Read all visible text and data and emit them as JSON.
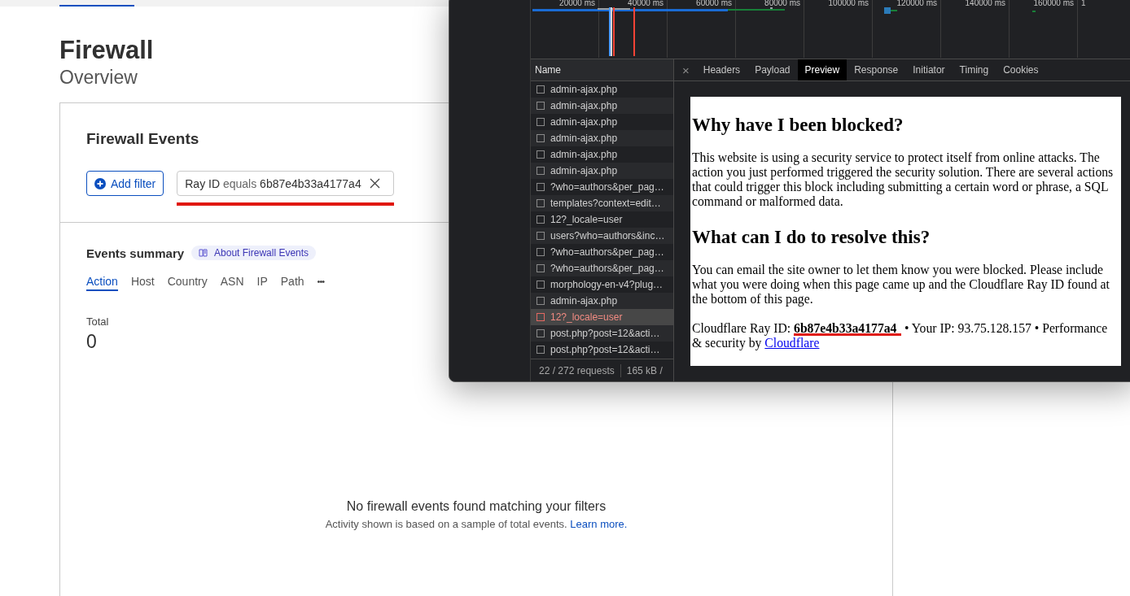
{
  "page": {
    "title": "Firewall",
    "subtitle": "Overview"
  },
  "card": {
    "title": "Firewall Events",
    "add_filter": "Add filter",
    "filter": {
      "field": "Ray ID",
      "operator": "equals",
      "value": "6b87e4b33a4177a4"
    },
    "summary_title": "Events summary",
    "about_link": "About Firewall Events",
    "tabs": [
      {
        "label": "Action",
        "selected": true
      },
      {
        "label": "Host",
        "selected": false
      },
      {
        "label": "Country",
        "selected": false
      },
      {
        "label": "ASN",
        "selected": false
      },
      {
        "label": "IP",
        "selected": false
      },
      {
        "label": "Path",
        "selected": false
      }
    ],
    "more": "•••",
    "total_label": "Total",
    "total_value": "0",
    "empty_title": "No firewall events found matching your filters",
    "empty_text": "Activity shown is based on a sample of total events.",
    "learn_more": "Learn more."
  },
  "devtools": {
    "timeline_ticks": [
      "20000 ms",
      "40000 ms",
      "60000 ms",
      "80000 ms",
      "100000 ms",
      "120000 ms",
      "140000 ms",
      "160000 ms",
      "1"
    ],
    "name_header": "Name",
    "requests": [
      {
        "name": "admin-ajax.php",
        "selected": false,
        "failed": false
      },
      {
        "name": "admin-ajax.php",
        "selected": false,
        "failed": false
      },
      {
        "name": "admin-ajax.php",
        "selected": false,
        "failed": false
      },
      {
        "name": "admin-ajax.php",
        "selected": false,
        "failed": false
      },
      {
        "name": "admin-ajax.php",
        "selected": false,
        "failed": false
      },
      {
        "name": "admin-ajax.php",
        "selected": false,
        "failed": false
      },
      {
        "name": "?who=authors&per_pag…",
        "selected": false,
        "failed": false
      },
      {
        "name": "templates?context=edit…",
        "selected": false,
        "failed": false
      },
      {
        "name": "12?_locale=user",
        "selected": false,
        "failed": false
      },
      {
        "name": "users?who=authors&inc…",
        "selected": false,
        "failed": false
      },
      {
        "name": "?who=authors&per_pag…",
        "selected": false,
        "failed": false
      },
      {
        "name": "?who=authors&per_pag…",
        "selected": false,
        "failed": false
      },
      {
        "name": "morphology-en-v4?plug…",
        "selected": false,
        "failed": false
      },
      {
        "name": "admin-ajax.php",
        "selected": false,
        "failed": false
      },
      {
        "name": "12?_locale=user",
        "selected": true,
        "failed": true
      },
      {
        "name": "post.php?post=12&acti…",
        "selected": false,
        "failed": false
      },
      {
        "name": "post.php?post=12&acti…",
        "selected": false,
        "failed": false
      }
    ],
    "footer": {
      "count": "22 / 272 requests",
      "size": "165 kB /"
    },
    "close": "×",
    "tabs": [
      {
        "label": "Headers",
        "selected": false
      },
      {
        "label": "Payload",
        "selected": false
      },
      {
        "label": "Preview",
        "selected": true
      },
      {
        "label": "Response",
        "selected": false
      },
      {
        "label": "Initiator",
        "selected": false
      },
      {
        "label": "Timing",
        "selected": false
      },
      {
        "label": "Cookies",
        "selected": false
      }
    ],
    "preview": {
      "heading_1": "Why have I been blocked?",
      "paragraph_1": "This website is using a security service to protect itself from online attacks. The action you just performed triggered the security solution. There are several actions that could trigger this block including submitting a certain word or phrase, a SQL command or malformed data.",
      "heading_2": "What can I do to resolve this?",
      "paragraph_2": "You can email the site owner to let them know you were blocked. Please include what you were doing when this page came up and the Cloudflare Ray ID found at the bottom of this page.",
      "ray_label": "Cloudflare Ray ID:",
      "ray_id": "6b87e4b33a4177a4",
      "ray_rest": "• Your IP: 93.75.128.157 • Performance & security by",
      "link": "Cloudflare"
    }
  }
}
